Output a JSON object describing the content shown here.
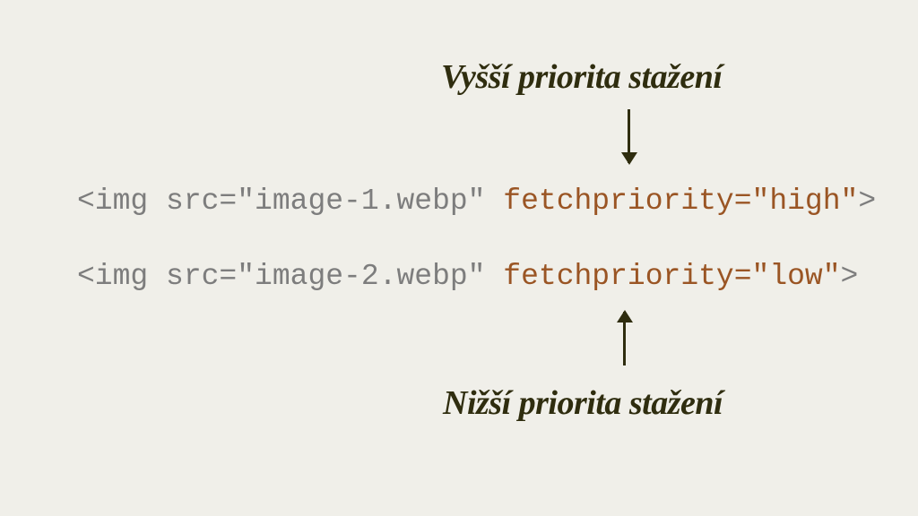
{
  "headings": {
    "top": "Vyšší priorita stažení",
    "bottom": "Nižší priorita stažení"
  },
  "code": {
    "line1": {
      "prefix": "<img src=\"image-1.webp\" ",
      "highlight": "fetchpriority=\"high\"",
      "suffix": ">"
    },
    "line2": {
      "prefix": "<img src=\"image-2.webp\" ",
      "highlight": "fetchpriority=\"low\"",
      "suffix": ">"
    }
  }
}
